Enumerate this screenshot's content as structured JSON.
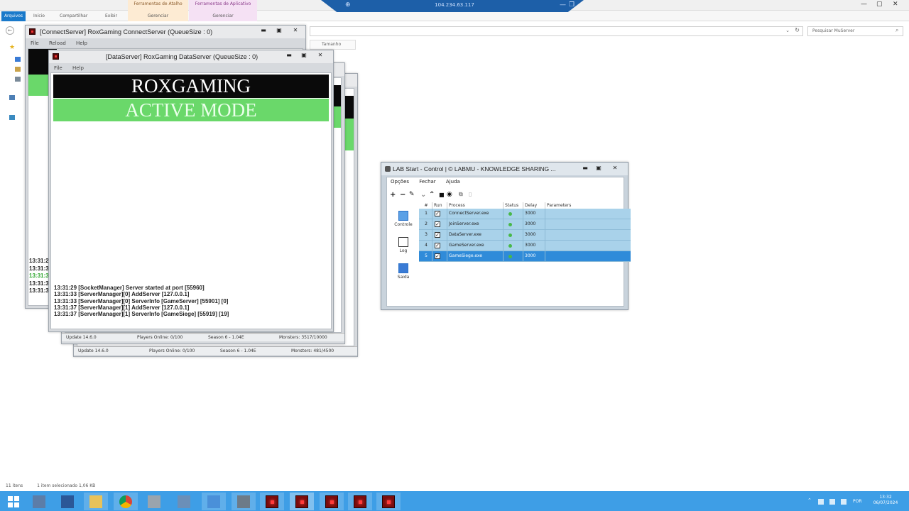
{
  "explorer": {
    "tabs": [
      "Arquivos",
      "Início",
      "Compartilhar",
      "Exibir"
    ],
    "context_tabs": [
      {
        "group": "Ferramentas de Atalho",
        "tab": "Gerenciar"
      },
      {
        "group": "Ferramentas de Aplicativo",
        "tab": "Gerenciar"
      }
    ],
    "search_placeholder": "Pesquisar MuServer",
    "column_header": "Tamanho",
    "status_items": "11 itens",
    "status_selected": "1 item selecionado  1,06 KB"
  },
  "rdp": {
    "ip": "104.234.63.117"
  },
  "connectserver": {
    "title": "[ConnectServer] RoxGaming ConnectServer (QueueSize : 0)",
    "menu": [
      "File",
      "Reload",
      "Help"
    ]
  },
  "gameserver": {
    "status": {
      "update": "Update 14.6.0",
      "players": "Players Online: 0/100",
      "season": "Season 6 - 1.04E",
      "monsters": "Monsters: 481/4500"
    }
  },
  "joinserver": {
    "status": {
      "update": "Update 14.6.0",
      "players": "Players Online: 0/100",
      "season": "Season 6 - 1.04E",
      "monsters": "Monsters: 3517/10000"
    }
  },
  "dataserver": {
    "title": "[DataServer] RoxGaming DataServer (QueueSize : 0)",
    "menu": [
      "File",
      "Help"
    ],
    "banner_title": "ROXGAMING",
    "banner_mode": "ACTIVE MODE",
    "log": [
      "13:31:29 [SocketManager] Server started at port [55960]",
      "13:31:33 [ServerManager][0] AddServer [127.0.0.1]",
      "13:31:33 [ServerManager][0] ServerInfo [GameServer] [55901] [0]",
      "13:31:37 [ServerManager][1] AddServer [127.0.0.1]",
      "13:31:37 [ServerManager][1] ServerInfo [GameSiege] [55919] [19]"
    ],
    "left_log_stub": [
      "13:31:2",
      "13:31:3",
      "13:31:3",
      "13:31:3",
      "13:31:3"
    ]
  },
  "lab": {
    "title": "LAB Start - Control | © LABMU - KNOWLEDGE SHARING ...",
    "menu": [
      "Opções",
      "Fechar",
      "Ajuda"
    ],
    "sidebar": [
      "Controle",
      "Log",
      "Saida"
    ],
    "columns": [
      "#",
      "Run",
      "Process",
      "Status",
      "Delay",
      "Parameters"
    ],
    "rows": [
      {
        "n": "1",
        "process": "ConnectServer.exe",
        "delay": "3000"
      },
      {
        "n": "2",
        "process": "JoinServer.exe",
        "delay": "3000"
      },
      {
        "n": "3",
        "process": "DataServer.exe",
        "delay": "3000"
      },
      {
        "n": "4",
        "process": "GameServer.exe",
        "delay": "3000"
      },
      {
        "n": "5",
        "process": "GameSiege.exe",
        "delay": "3000"
      }
    ],
    "selected_row": 5
  },
  "taskbar": {
    "lang": "POR",
    "time": "13:32",
    "date": "06/07/2024"
  },
  "colors": {
    "taskbar": "#3e9ee6",
    "banner_black": "#0a0a0a",
    "banner_green": "#6ad86a",
    "row_blue": "#a9d2ea",
    "row_selected": "#2f8bd9"
  }
}
